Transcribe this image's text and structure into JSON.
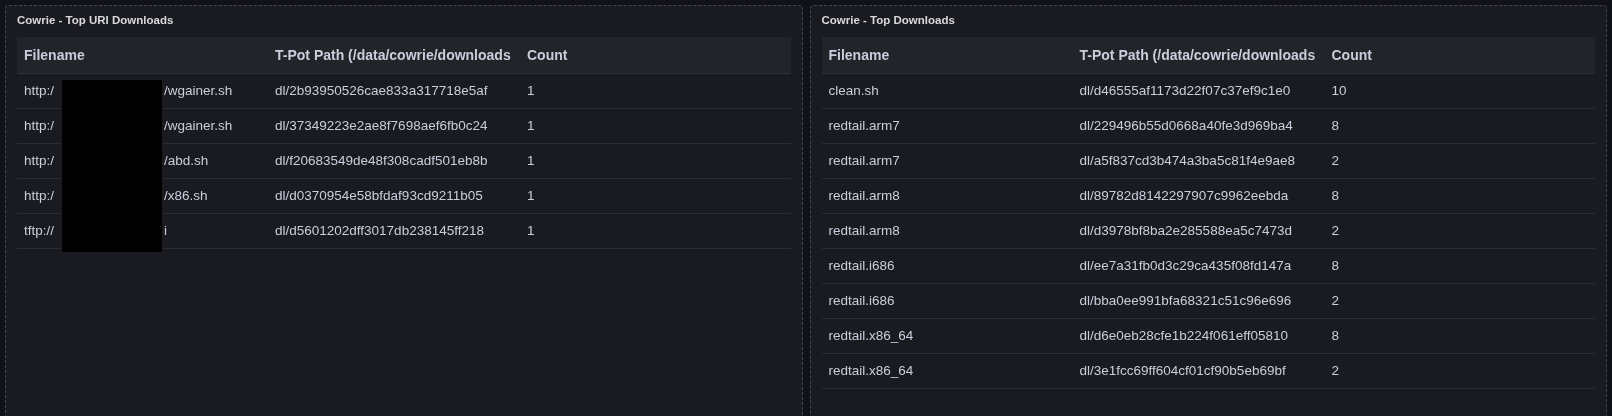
{
  "panels": [
    {
      "title": "Cowrie - Top URI Downloads",
      "redacted": true,
      "columns": [
        "Filename",
        "T-Pot Path (/data/cowrie/downloads",
        "Count"
      ],
      "rows": [
        {
          "filename": [
            "http:/",
            "/wgainer.sh"
          ],
          "path": "dl/2b93950526cae833a317718e5af",
          "count": "1"
        },
        {
          "filename": [
            "http:/",
            "/wgainer.sh"
          ],
          "path": "dl/37349223e2ae8f7698aef6fb0c24",
          "count": "1"
        },
        {
          "filename": [
            "http:/",
            "/abd.sh"
          ],
          "path": "dl/f20683549de48f308cadf501eb8b",
          "count": "1"
        },
        {
          "filename": [
            "http:/",
            "/x86.sh"
          ],
          "path": "dl/d0370954e58bfdaf93cd9211b05",
          "count": "1"
        },
        {
          "filename": [
            "tftp://",
            "i"
          ],
          "path": "dl/d5601202dff3017db238145ff218",
          "count": "1"
        }
      ]
    },
    {
      "title": "Cowrie - Top Downloads",
      "redacted": false,
      "columns": [
        "Filename",
        "T-Pot Path (/data/cowrie/downloads",
        "Count"
      ],
      "rows": [
        {
          "filename": [
            "clean.sh"
          ],
          "path": "dl/d46555af1173d22f07c37ef9c1e0",
          "count": "10"
        },
        {
          "filename": [
            "redtail.arm7"
          ],
          "path": "dl/229496b55d0668a40fe3d969ba4",
          "count": "8"
        },
        {
          "filename": [
            "redtail.arm7"
          ],
          "path": "dl/a5f837cd3b474a3ba5c81f4e9ae8",
          "count": "2"
        },
        {
          "filename": [
            "redtail.arm8"
          ],
          "path": "dl/89782d8142297907c9962eebda",
          "count": "8"
        },
        {
          "filename": [
            "redtail.arm8"
          ],
          "path": "dl/d3978bf8ba2e285588ea5c7473d",
          "count": "2"
        },
        {
          "filename": [
            "redtail.i686"
          ],
          "path": "dl/ee7a31fb0d3c29ca435f08fd147a",
          "count": "8"
        },
        {
          "filename": [
            "redtail.i686"
          ],
          "path": "dl/bba0ee991bfa68321c51c96e696",
          "count": "2"
        },
        {
          "filename": [
            "redtail.x86_64"
          ],
          "path": "dl/d6e0eb28cfe1b224f061eff05810",
          "count": "8"
        },
        {
          "filename": [
            "redtail.x86_64"
          ],
          "path": "dl/3e1fcc69ff604cf01cf90b5eb69bf",
          "count": "2"
        }
      ]
    }
  ]
}
